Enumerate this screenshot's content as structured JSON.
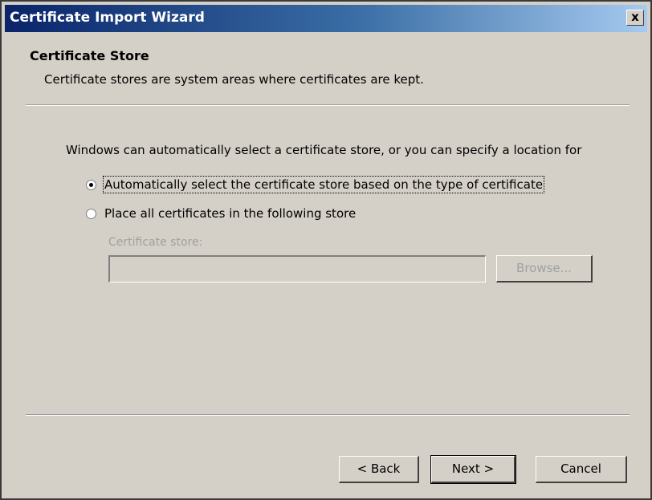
{
  "window": {
    "title": "Certificate Import Wizard",
    "close_label": "x"
  },
  "header": {
    "title": "Certificate Store",
    "description": "Certificate stores are system areas where certificates are kept."
  },
  "body": {
    "intro": "Windows can automatically select a certificate store, or you can specify a location for",
    "options": [
      {
        "label": "Automatically select the certificate store based on the type of certificate",
        "checked": true
      },
      {
        "label": "Place all certificates in the following store",
        "checked": false
      }
    ],
    "store_field": {
      "label": "Certificate store:",
      "value": "",
      "enabled": false
    },
    "browse_label": "Browse..."
  },
  "footer": {
    "back_label": "< Back",
    "next_label": "Next >",
    "cancel_label": "Cancel"
  }
}
